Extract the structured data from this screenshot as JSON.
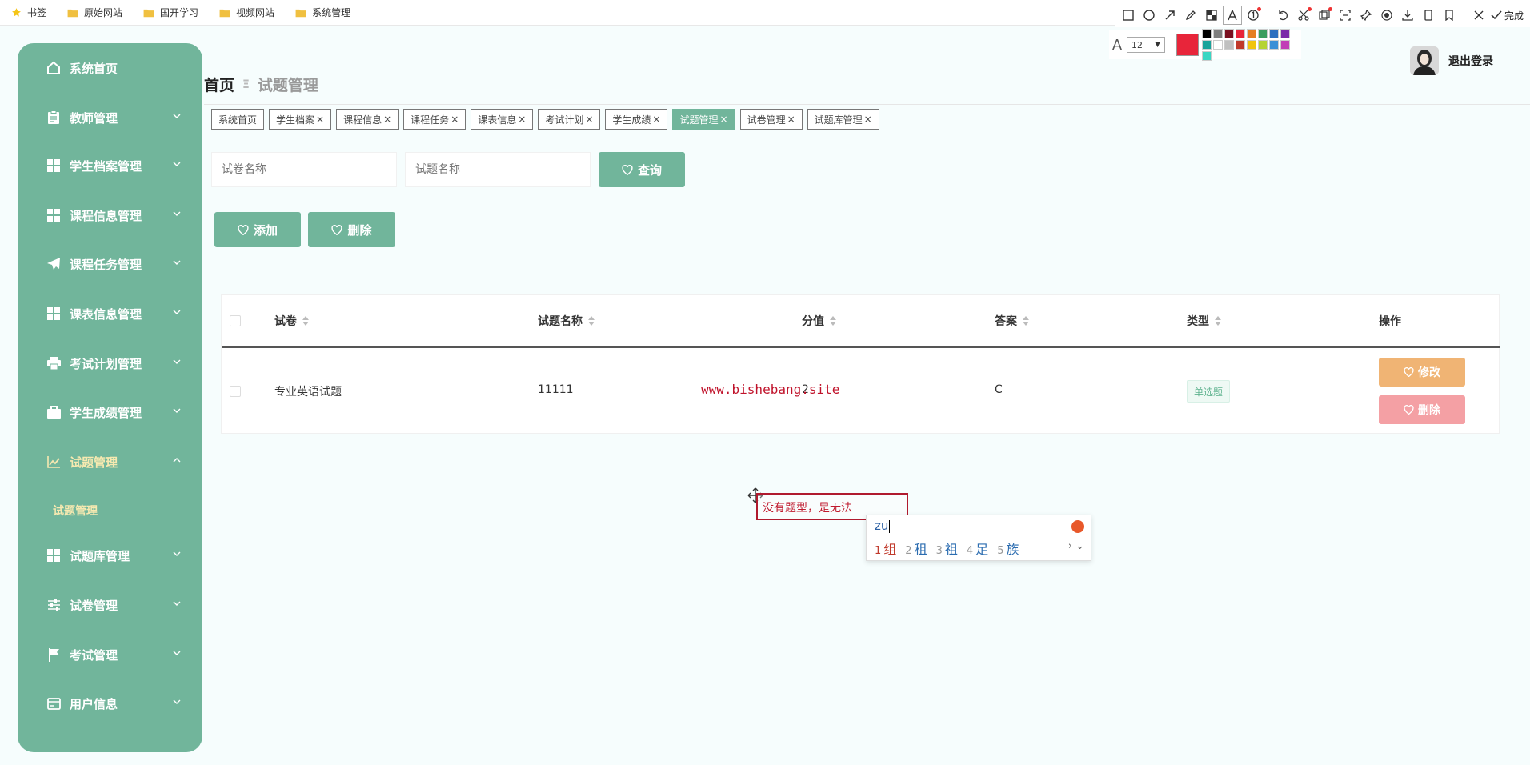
{
  "bookmarks": [
    "书签",
    "原始网站",
    "国开学习",
    "视频网站",
    "系统管理"
  ],
  "snip": {
    "done_label": "完成",
    "font_size": "12",
    "palette": [
      "#000000",
      "#7f7f7f",
      "#7a1020",
      "#e8253a",
      "#e67e22",
      "#3a9d5d",
      "#2c6fbf",
      "#7b2aa8",
      "#1aa39a",
      "#ffffff",
      "#c0c0c0",
      "#c0392b",
      "#f1c40f",
      "#b5d334",
      "#3b8fd6",
      "#c13fb6",
      "#39d6c3"
    ]
  },
  "sidebar": {
    "items": [
      {
        "label": "系统首页",
        "icon": "home-icon"
      },
      {
        "label": "教师管理",
        "icon": "clipboard-icon"
      },
      {
        "label": "学生档案管理",
        "icon": "grid-icon"
      },
      {
        "label": "课程信息管理",
        "icon": "grid-icon"
      },
      {
        "label": "课程任务管理",
        "icon": "send-icon"
      },
      {
        "label": "课表信息管理",
        "icon": "grid-icon"
      },
      {
        "label": "考试计划管理",
        "icon": "printer-icon"
      },
      {
        "label": "学生成绩管理",
        "icon": "briefcase-icon"
      },
      {
        "label": "试题管理",
        "icon": "chart-icon"
      },
      {
        "label": "试题库管理",
        "icon": "grid-icon"
      },
      {
        "label": "试卷管理",
        "icon": "sliders-icon"
      },
      {
        "label": "考试管理",
        "icon": "flag-icon"
      },
      {
        "label": "用户信息",
        "icon": "card-icon"
      }
    ],
    "sub_item": "试题管理"
  },
  "header": {
    "home": "首页",
    "separator": "Ξ",
    "current": "试题管理",
    "logout": "退出登录"
  },
  "tags": [
    "系统首页",
    "学生档案",
    "课程信息",
    "课程任务",
    "课表信息",
    "考试计划",
    "学生成绩",
    "试题管理",
    "试卷管理",
    "试题库管理"
  ],
  "search": {
    "paper_placeholder": "试卷名称",
    "question_placeholder": "试题名称",
    "query_label": "查询"
  },
  "actions": {
    "add_label": "添加",
    "delete_label": "删除"
  },
  "table": {
    "columns": [
      "试卷",
      "试题名称",
      "分值",
      "答案",
      "类型",
      "操作"
    ],
    "row": {
      "paper": "专业英语试题",
      "question": "11111",
      "score": "2",
      "answer": "C",
      "type": "单选题",
      "edit_label": "修改",
      "delete_label": "删除"
    }
  },
  "watermark": "www.bishebang.site",
  "annotation": "没有题型，是无法",
  "ime": {
    "pinyin": "zu",
    "candidates": [
      {
        "n": "1",
        "c": "组"
      },
      {
        "n": "2",
        "c": "租"
      },
      {
        "n": "3",
        "c": "祖"
      },
      {
        "n": "4",
        "c": "足"
      },
      {
        "n": "5",
        "c": "族"
      }
    ]
  }
}
